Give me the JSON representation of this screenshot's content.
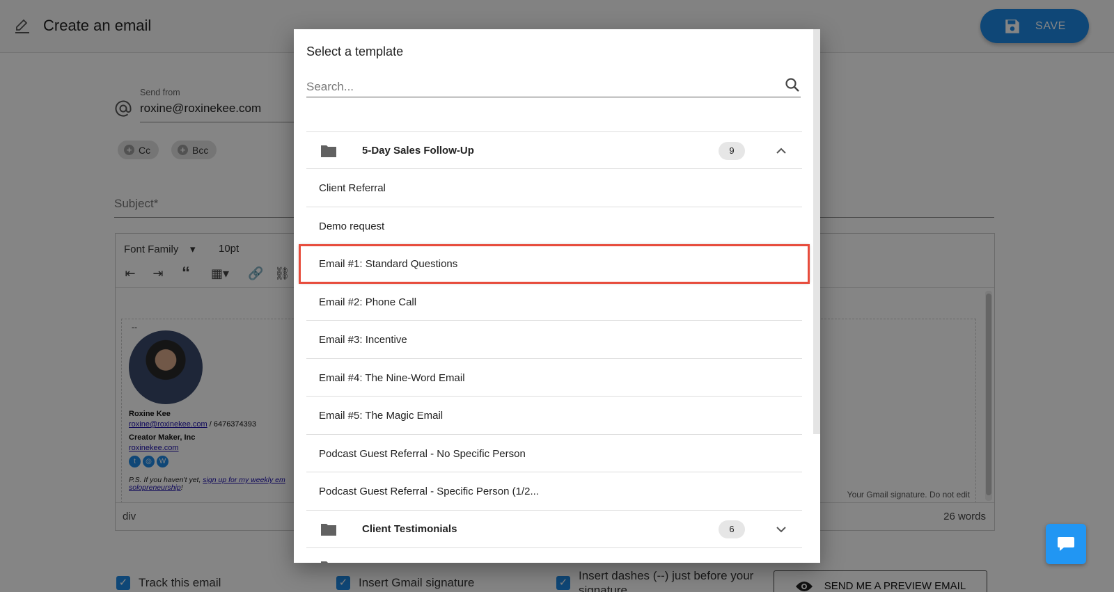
{
  "page": {
    "title": "Create an email",
    "save_label": "SAVE"
  },
  "from": {
    "label": "Send from",
    "value": "roxine@roxinekee.com"
  },
  "chips": {
    "cc": "Cc",
    "bcc": "Bcc"
  },
  "subject": {
    "placeholder": "Subject*"
  },
  "editor": {
    "font_family": "Font Family",
    "font_size": "10pt",
    "status_path": "div",
    "word_count": "26 words",
    "signature": {
      "dash": "--",
      "name": "Roxine Kee",
      "email": "roxine@roxinekee.com",
      "phone": " / 6476374393",
      "company": "Creator Maker, Inc",
      "website": "roxinekee.com",
      "ps_prefix": "P.S. If you haven't yet, ",
      "ps_link": "sign up for my weekly em",
      "ps_link2": "solopreneurship",
      "ps_suffix": "!",
      "note": "Your Gmail signature. Do not edit"
    }
  },
  "options": {
    "track": "Track this email",
    "gmail_signature": "Insert Gmail signature",
    "dashes_line1": "Insert dashes (--) just before your",
    "dashes_line2": "signature",
    "preview_label": "SEND ME A PREVIEW EMAIL"
  },
  "modal": {
    "title": "Select a template",
    "search_placeholder": "Search...",
    "groups": [
      {
        "name": "5-Day Sales Follow-Up",
        "count": "9",
        "expanded": true,
        "items": [
          "Client Referral",
          "Demo request",
          "Email #1: Standard Questions",
          "Email #2: Phone Call",
          "Email #3: Incentive",
          "Email #4: The Nine-Word Email",
          "Email #5: The Magic Email",
          "Podcast Guest Referral - No Specific Person",
          "Podcast Guest Referral - Specific Person (1/2..."
        ],
        "selected_index": 2
      },
      {
        "name": "Client Testimonials",
        "count": "6",
        "expanded": false
      }
    ]
  },
  "colors": {
    "accent": "#1e88e5",
    "highlight": "#e74c3c",
    "overlay": "rgba(0,0,0,0.48)"
  }
}
